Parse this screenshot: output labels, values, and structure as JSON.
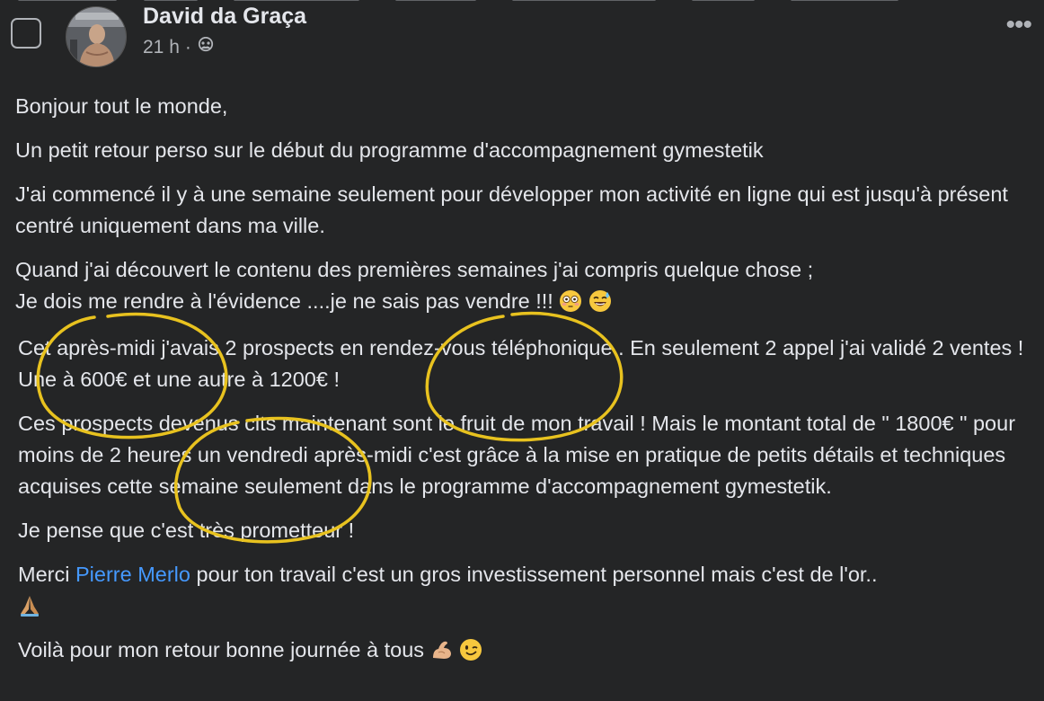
{
  "post": {
    "author": "David da Graça",
    "time": "21 h",
    "meta_separator": "·",
    "privacy_icon": "friends-icon",
    "more_icon": "more-options-icon",
    "paragraphs": {
      "p1": "Bonjour tout le monde,",
      "p2": "Un petit retour perso sur le début du programme d'accompagnement gymestetik",
      "p3": "J'ai commencé il y à une semaine seulement pour développer mon activité en ligne qui est jusqu'à présent centré uniquement dans ma ville.",
      "p4_line1": "Quand j'ai découvert le contenu des premières semaines j'ai compris quelque chose ;",
      "p4_line2": "Je dois me rendre à l'évidence ....je ne sais pas vendre !!!",
      "p5": "Cet après-midi j'avais 2 prospects en rendez-vous téléphonique . En seulement 2 appel j'ai validé 2 ventes ! Une à 600€ et une autre à 1200€ !",
      "p6": "Ces prospects devenus clts maintenant sont le fruit de mon travail ! Mais le montant total de \" 1800€ \" pour moins de 2 heures un vendredi après-midi c'est grâce à la mise en pratique de petits détails et techniques acquises cette semaine seulement dans le programme d'accompagnement gymestetik.",
      "p7": "Je pense que c'est très prometteur !",
      "p8_before": "Merci ",
      "p8_link": "Pierre Merlo",
      "p8_after": " pour ton travail c'est un gros investissement personnel mais c'est de l'or..",
      "p9": "Voilà pour mon retour bonne journée à tous"
    },
    "emojis": {
      "p4": [
        "flushed-face-emoji",
        "grinning-sweat-emoji"
      ],
      "p8": [
        "folded-hands-emoji"
      ],
      "p9": [
        "flexed-biceps-emoji",
        "winking-face-emoji"
      ]
    }
  },
  "colors": {
    "background": "#242526",
    "text": "#e4e6eb",
    "secondary_text": "#b0b3b8",
    "link": "#4599ff",
    "highlight_circles": "#e8c21f"
  }
}
